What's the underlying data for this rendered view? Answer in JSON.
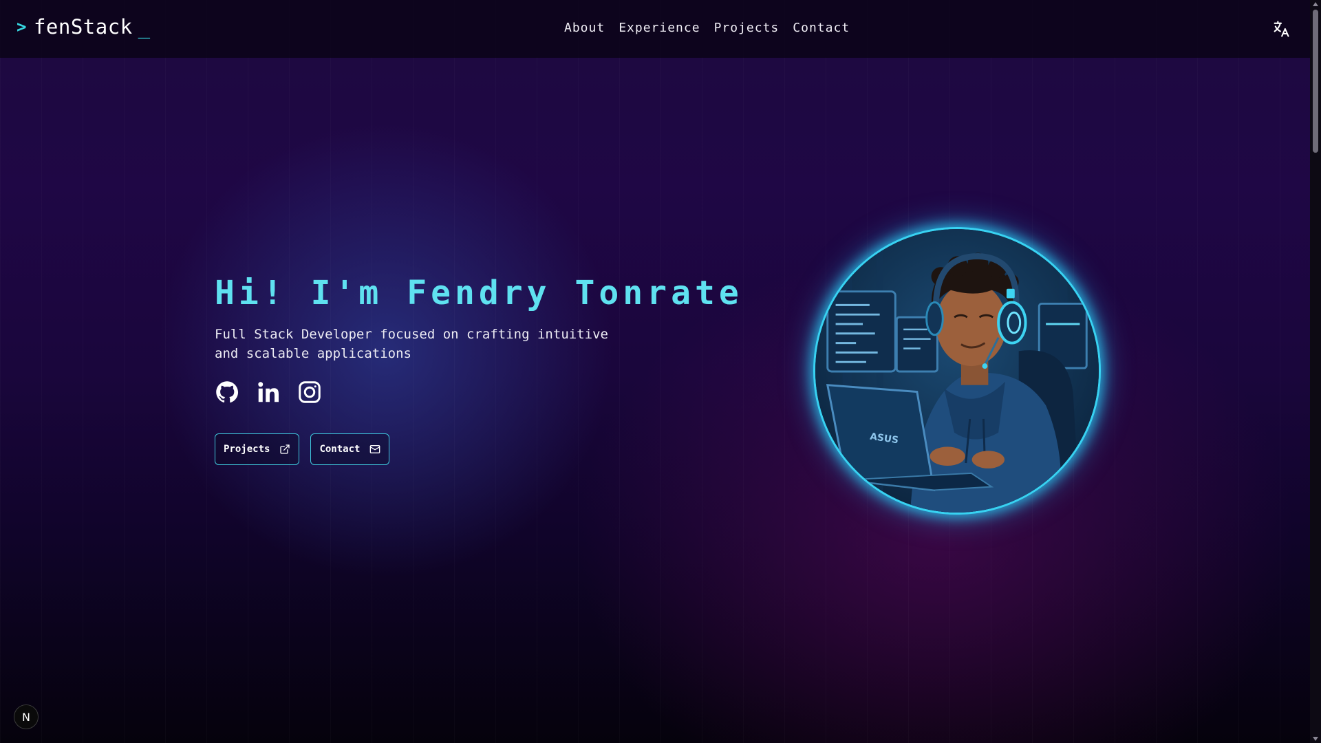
{
  "brand": {
    "prompt": ">",
    "name": "fenStack",
    "cursor": "_"
  },
  "nav": {
    "items": [
      {
        "label": "About"
      },
      {
        "label": "Experience"
      },
      {
        "label": "Projects"
      },
      {
        "label": "Contact"
      }
    ],
    "translate_icon": "translate-icon"
  },
  "hero": {
    "title": "Hi! I'm Fendry Tonrate",
    "subtitle": "Full Stack Developer focused on crafting intuitive and scalable applications",
    "socials": [
      {
        "icon": "github-icon"
      },
      {
        "icon": "linkedin-icon"
      },
      {
        "icon": "instagram-icon"
      }
    ],
    "buttons": {
      "projects": {
        "label": "Projects",
        "icon": "external-link-icon"
      },
      "contact": {
        "label": "Contact",
        "icon": "mail-icon"
      }
    },
    "avatar": {
      "laptop_brand": "ASUS"
    }
  },
  "dev_badge": {
    "letter": "N"
  },
  "colors": {
    "accent": "#5fe1f0",
    "button_border": "#3fc9dd",
    "background_top": "#1f0745",
    "background_bottom": "#05020c"
  }
}
